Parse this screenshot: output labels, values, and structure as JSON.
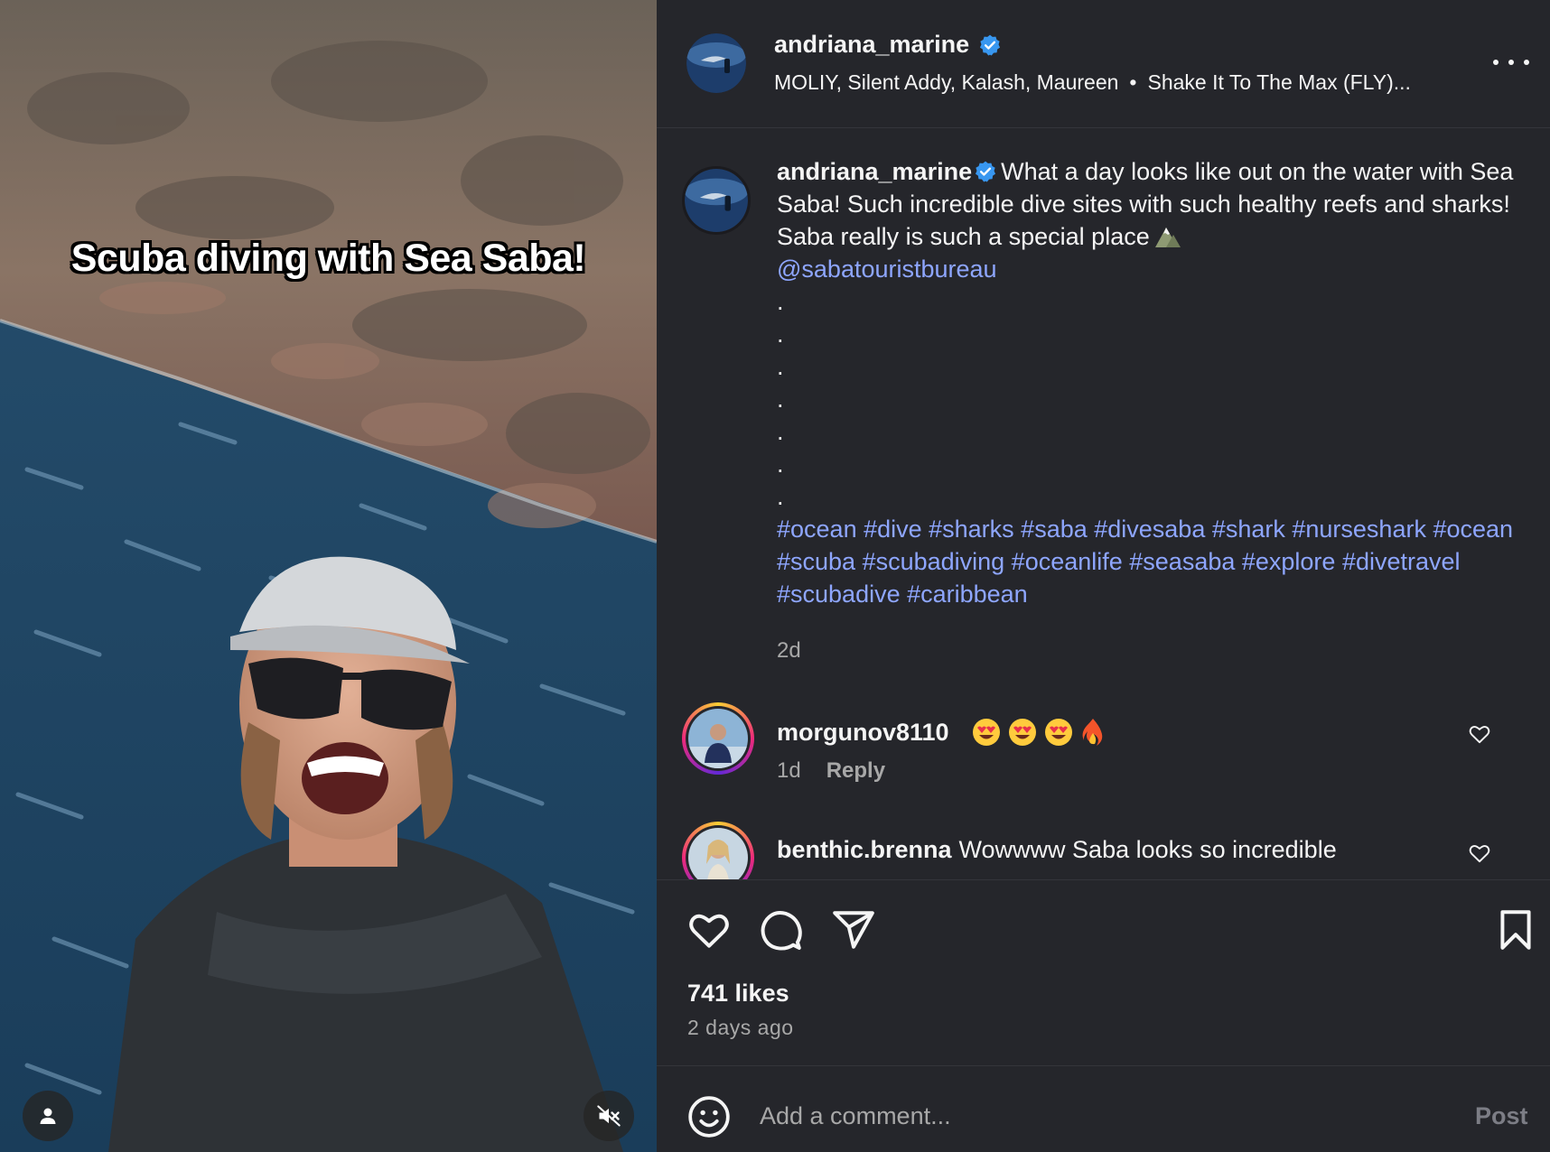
{
  "media": {
    "overlay_caption": "Scuba diving with Sea Saba!",
    "tag_icon": "user-tag-icon",
    "mute_icon": "speaker-muted-icon"
  },
  "header": {
    "username": "andriana_marine",
    "verified": true,
    "audio_artists": "MOLIY, Silent Addy, Kalash, Maureen",
    "audio_separator": "•",
    "audio_title": "Shake It To The Max (FLY)...",
    "more_icon": "more-options-icon"
  },
  "caption": {
    "username": "andriana_marine",
    "text": "What a day looks like out on the water with Sea Saba! Such incredible dive sites with such healthy reefs and sharks! Saba really is such a special place",
    "mention": "@sabatouristbureau",
    "dots": [
      ".",
      ".",
      ".",
      ".",
      ".",
      ".",
      "."
    ],
    "hashtags": "#ocean #dive #sharks #saba #divesaba #shark #nurseshark #ocean #scuba #scubadiving #oceanlife #seasaba #explore #divetravel #scubadive #caribbean",
    "time": "2d"
  },
  "comments": [
    {
      "username": "morgunov8110",
      "text": "",
      "emojis": [
        "heart-eyes-emoji",
        "heart-eyes-emoji",
        "heart-eyes-emoji",
        "fire-emoji"
      ],
      "time": "1d",
      "reply_label": "Reply"
    },
    {
      "username": "benthic.brenna",
      "text": "Wowwww Saba looks so incredible"
    }
  ],
  "actions": {
    "likes": "741 likes",
    "posted": "2 days ago"
  },
  "add_comment": {
    "placeholder": "Add a comment...",
    "post_label": "Post"
  },
  "colors": {
    "background": "#25262b",
    "link": "#8ea6ff",
    "muted_text": "#a8a8a8",
    "verified": "#3897f0"
  }
}
